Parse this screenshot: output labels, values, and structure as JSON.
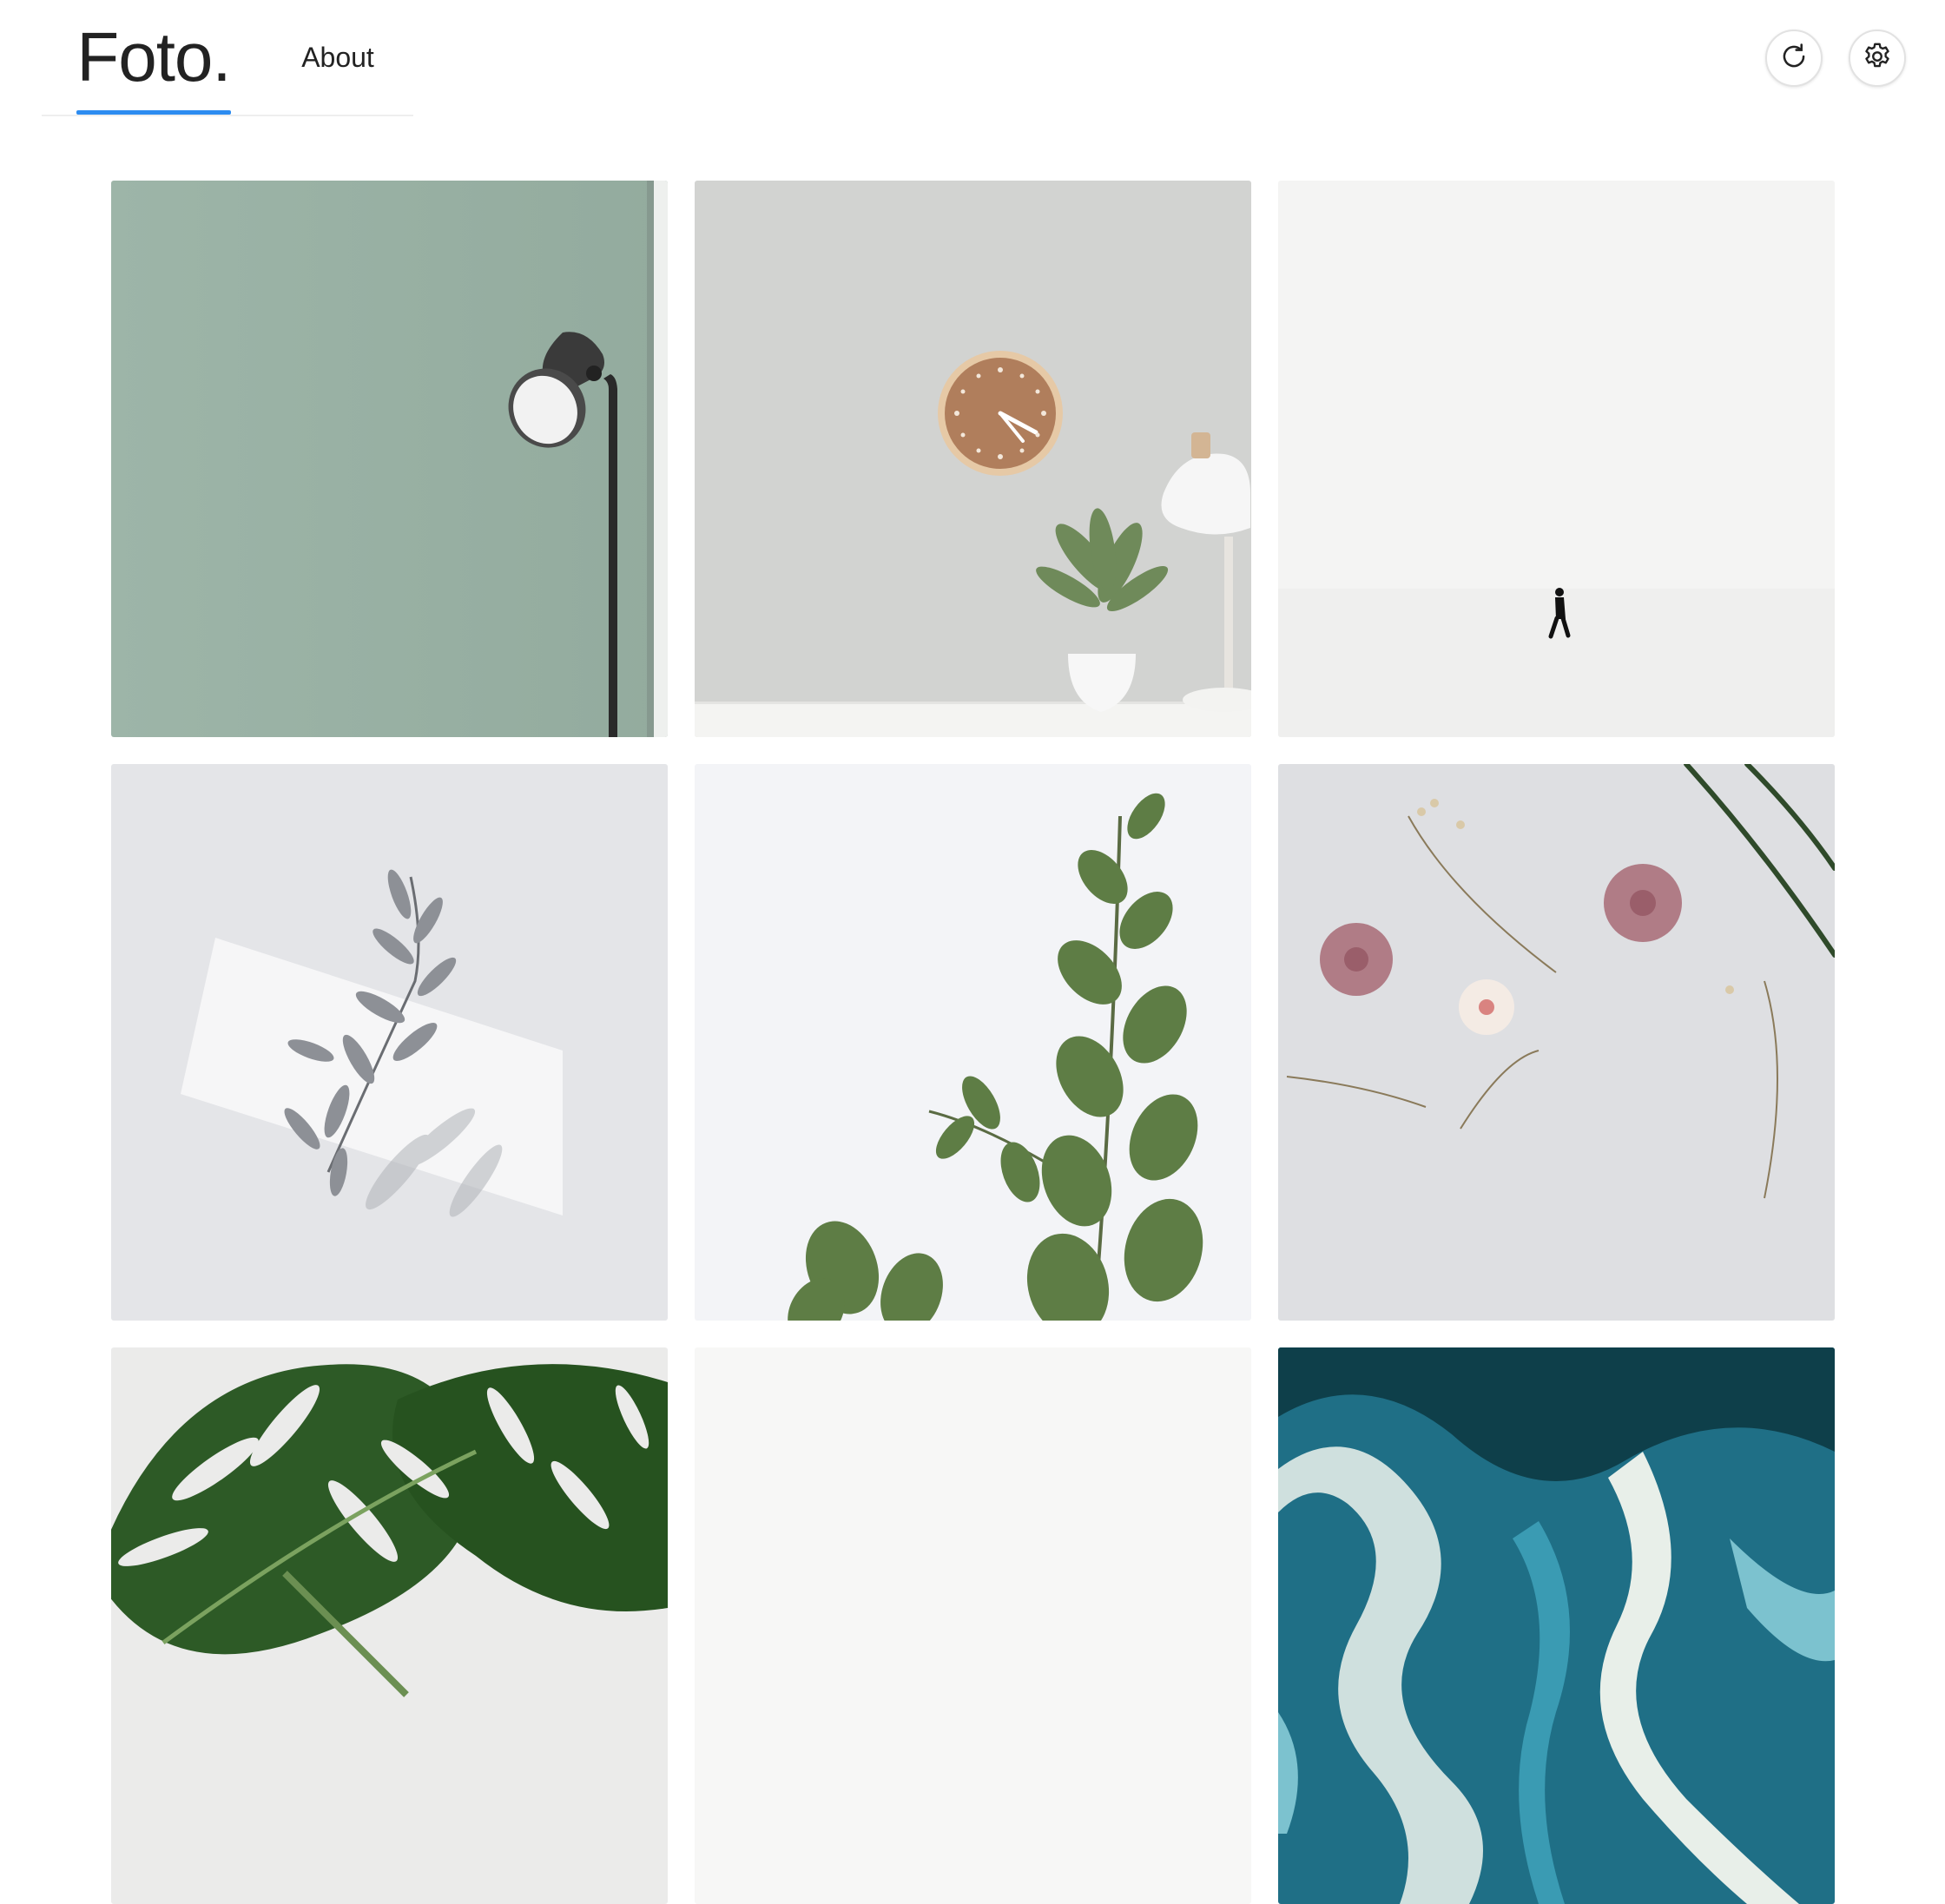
{
  "header": {
    "brand_label": "Foto.",
    "nav_about": "About",
    "active_tab": "Foto.",
    "accent_color": "#2d8cf0",
    "actions": [
      {
        "icon": "refresh-icon"
      },
      {
        "icon": "gear-icon"
      }
    ]
  },
  "gallery": {
    "photos": [
      {
        "subject": "floor-lamp-green-wall"
      },
      {
        "subject": "wall-clock-plant-lamp"
      },
      {
        "subject": "person-walking-snow"
      },
      {
        "subject": "silver-leaves-shadow"
      },
      {
        "subject": "eucalyptus-branch"
      },
      {
        "subject": "dried-flowers-flatlay"
      },
      {
        "subject": "monstera-leaf"
      },
      {
        "subject": "blank-white"
      },
      {
        "subject": "teal-marble-swirl"
      }
    ]
  }
}
